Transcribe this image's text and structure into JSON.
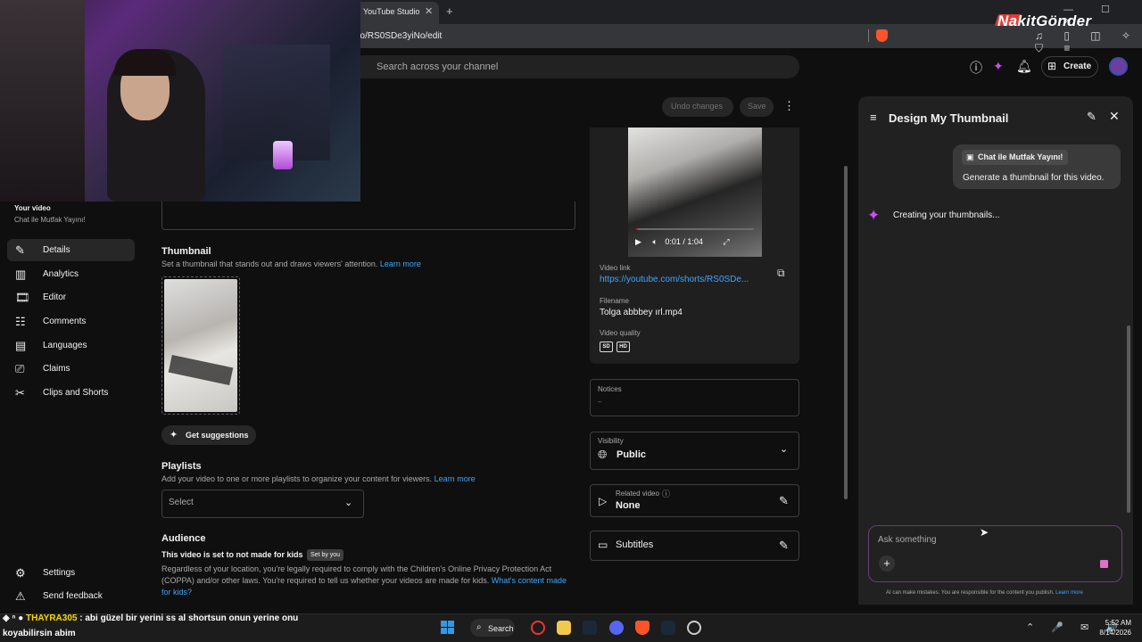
{
  "browser": {
    "tab_title": "YouTube Studio",
    "tab_close": "✕",
    "new_tab": "+",
    "url": "eo/RS0SDe3yiNo/edit",
    "window_controls": "—  ☐  ✕",
    "toolbar_icons": "♫ ▯ ◫ ✧ ⛉ ≡"
  },
  "overlay": {
    "brand": "NakitGönder",
    "chat_user": "THAYRA305",
    "chat_line1": " : abi güzel bir yerini ss al shortsun onun yerine onu",
    "chat_line2": "koyabilirsin abim",
    "chat_prefix": "◈ ⁿ ●"
  },
  "header": {
    "search_placeholder": "Search across your channel",
    "create_label": "Create"
  },
  "sidebar": {
    "your_video": "Your video",
    "video_title": "Chat ile Mutfak Yayını!",
    "items": [
      {
        "label": "Details",
        "icon": "✎",
        "active": true
      },
      {
        "label": "Analytics",
        "icon": "▥"
      },
      {
        "label": "Editor",
        "icon": "🎞"
      },
      {
        "label": "Comments",
        "icon": "☷"
      },
      {
        "label": "Languages",
        "icon": "▤"
      },
      {
        "label": "Claims",
        "icon": "⎚"
      },
      {
        "label": "Clips and Shorts",
        "icon": "✂"
      }
    ],
    "settings": "Settings",
    "feedback": "Send feedback"
  },
  "toolbar": {
    "undo_label": "Undo changes",
    "save_label": "Save"
  },
  "thumbnail": {
    "heading": "Thumbnail",
    "desc": "Set a thumbnail that stands out and draws viewers' attention.",
    "learn_more": "Learn more",
    "suggestions_label": "Get suggestions"
  },
  "playlists": {
    "heading": "Playlists",
    "desc": "Add your video to one or more playlists to organize your content for viewers.",
    "learn_more": "Learn more",
    "select_value": "Select"
  },
  "audience": {
    "heading": "Audience",
    "status": "This video is set to not made for kids",
    "set_by": "Set by you",
    "desc": "Regardless of your location, you're legally required to comply with the Children's Online Privacy Protection Act (COPPA) and/or other laws. You're required to tell us whether your videos are made for kids.",
    "link": "What's content made for kids?"
  },
  "video": {
    "time": "0:01 / 1:04",
    "progress_fraction": 0.016,
    "link_label": "Video link",
    "link": "https://youtube.com/shorts/RS0SDe...",
    "filename_label": "Filename",
    "filename": "Tolga abbbey ırl.mp4",
    "quality_label": "Video quality",
    "quality_badges": [
      "SD",
      "HD"
    ]
  },
  "notices": {
    "label": "Notices",
    "value": "–"
  },
  "visibility": {
    "label": "Visibility",
    "value": "Public"
  },
  "related": {
    "label": "Related video",
    "value": "None"
  },
  "subtitles": {
    "label": "Subtitles"
  },
  "ai_panel": {
    "title": "Design My Thumbnail",
    "chip": "Chat ile Mutfak Yayını!",
    "user_message": "Generate a thumbnail for this video.",
    "status": "Creating your thumbnails...",
    "input_placeholder": "Ask something",
    "footer": "AI can make mistakes. You are responsible for the content you publish.",
    "footer_link": "Learn more"
  },
  "taskbar": {
    "search_label": "Search",
    "time": "5:52 AM",
    "date": "8/14/2026",
    "tray": "⌃ 🎤 ✉ 🔊"
  },
  "colors": {
    "accent": "#3ea6ff",
    "background": "#0f0f0f",
    "ai_sparkle": "#d04cf0"
  }
}
